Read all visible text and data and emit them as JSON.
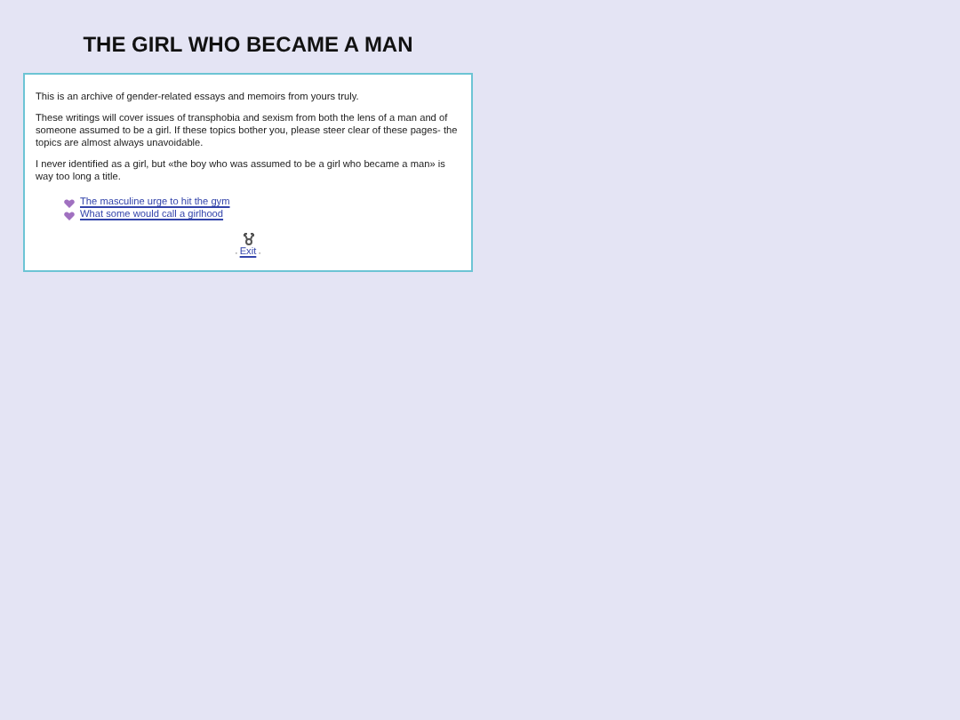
{
  "title": "THE GIRL WHO BECAME A MAN",
  "paragraphs": [
    "This is an archive of gender-related essays and memoirs from yours truly.",
    "These writings will cover issues of transphobia and sexism from both the lens of a man and of someone assumed to be a girl. If these topics bother you, please steer clear of these pages- the topics are almost always unavoidable.",
    "I never identified as a girl, but «the boy who was assumed to be a girl who became a man» is way too long a title."
  ],
  "links": [
    "The masculine urge to hit the gym",
    "What some would call a girlhood"
  ],
  "exit": {
    "prefix": "·",
    "label": "Exit",
    "suffix": "·"
  }
}
